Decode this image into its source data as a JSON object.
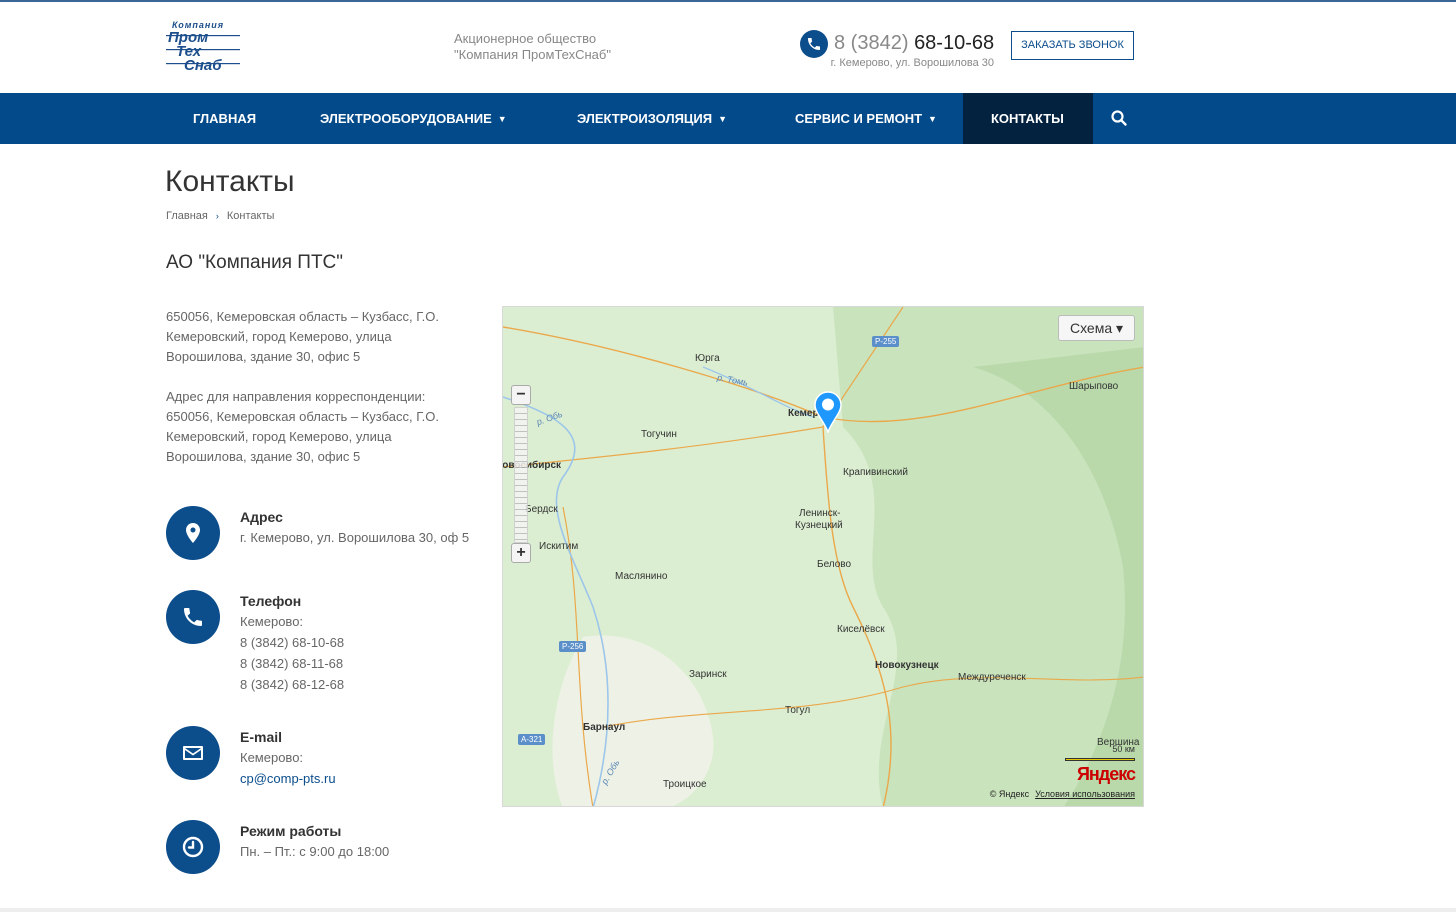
{
  "header": {
    "logo_lines": [
      "Компания",
      "Пром",
      "Тех",
      "Снаб"
    ],
    "company_line1": "Акционерное общество",
    "company_line2": "\"Компания ПромТехСнаб\"",
    "phone_code": "8 (3842)",
    "phone_number": "68-10-68",
    "phone_address": "г. Кемерово, ул. Ворошилова 30",
    "callback_label": "Заказать звонок"
  },
  "nav": {
    "items": [
      {
        "label": "Главная",
        "dropdown": false
      },
      {
        "label": "Электрооборудование",
        "dropdown": true
      },
      {
        "label": "Электроизоляция",
        "dropdown": true
      },
      {
        "label": "Сервис и ремонт",
        "dropdown": true
      },
      {
        "label": "Контакты",
        "dropdown": false,
        "active": true
      }
    ],
    "search_icon": "search-icon",
    "chevron": "⌄"
  },
  "page": {
    "title": "Контакты",
    "breadcrumb": [
      "Главная",
      "Контакты"
    ],
    "breadcrumb_sep": "›",
    "company_name": "АО \"Компания ПТС\"",
    "address_block": [
      "650056, Кемеровская область – Кузбасс, Г.О.",
      "Кемеровский, город Кемерово, улица",
      "Ворошилова, здание 30, офис 5",
      "",
      "Адрес для направления корреспонденции:",
      "650056, Кемеровская область – Кузбасс, Г.О.",
      "Кемеровский, город Кемерово, улица",
      "Ворошилова, здание 30, офис 5"
    ]
  },
  "contacts": {
    "address": {
      "title": "Адрес",
      "text": "г. Кемерово, ул. Ворошилова 30, оф 5"
    },
    "phone": {
      "title": "Телефон",
      "city": "Кемерово:",
      "numbers": [
        "8 (3842) 68-10-68",
        "8 (3842) 68-11-68",
        "8 (3842) 68-12-68"
      ]
    },
    "email": {
      "title": "E-mail",
      "city": "Кемерово:",
      "address": "cp@comp-pts.ru"
    },
    "hours": {
      "title": "Режим работы",
      "text": "Пн. – Пт.: с 9:00 до 18:00"
    }
  },
  "map": {
    "type_button": "Схема ▾",
    "zoom_in": "+",
    "zoom_out": "−",
    "cities": {
      "yurga": "Юрга",
      "kemerovo": "Кемерово",
      "sharypovo": "Шарыпово",
      "toguchin": "Тогучин",
      "novosibirsk": "Новосибирск",
      "krapivinsky": "Крапивинский",
      "berdsk": "Бердск",
      "iskitim": "Искитим",
      "leninsk1": "Ленинск-",
      "leninsk2": "Кузнецкий",
      "belovo": "Белово",
      "maslyanino": "Маслянино",
      "kiselevsk": "Киселёвск",
      "novokuznetsk": "Новокузнецк",
      "mezhdurechensk": "Междуреченск",
      "zarinsk": "Заринск",
      "togul": "Тогул",
      "barnaul": "Барнаул",
      "vershina": "Вершина",
      "troitskoe": "Троицкое"
    },
    "rivers": {
      "tom": "р. Томь",
      "ob1": "р. Обь",
      "ob2": "р. Обь"
    },
    "roads": {
      "r255": "Р-255",
      "r256": "Р-256",
      "a321": "А-321"
    },
    "scale_label": "50 км",
    "brand": "Яндекс",
    "copyright": "© Яндекс",
    "terms": "Условия использования"
  },
  "colors": {
    "primary": "#034a8b",
    "active_nav": "#02223f",
    "accent_link": "#0c4d8c"
  }
}
